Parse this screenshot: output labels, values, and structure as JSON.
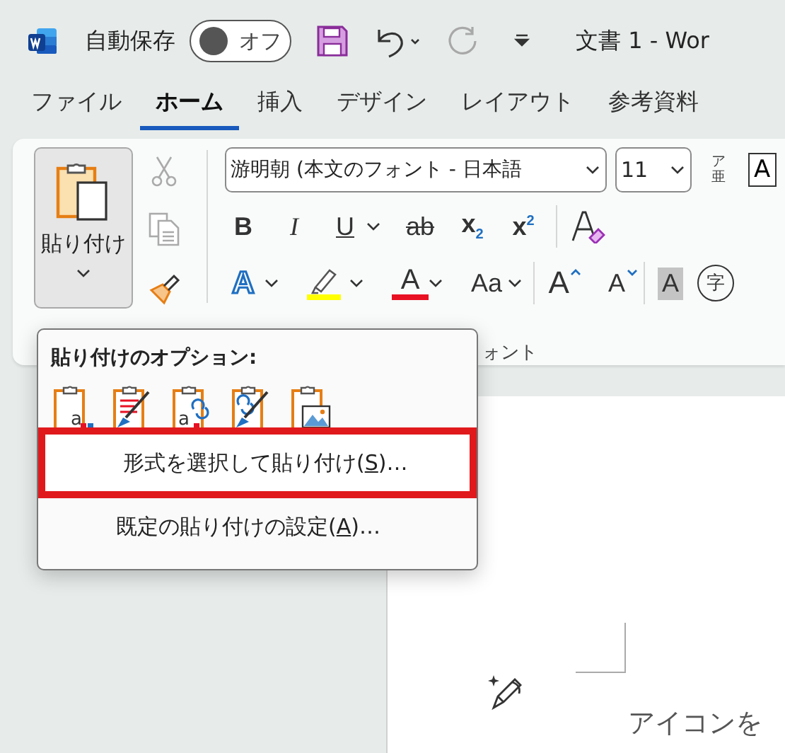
{
  "title_bar": {
    "autosave_label": "自動保存",
    "autosave_toggle": {
      "on": false,
      "label": "オフ"
    },
    "redo_disabled": true,
    "document_title": "文書 1  -  Wor"
  },
  "tabs": [
    {
      "label": "ファイル",
      "selected": false
    },
    {
      "label": "ホーム",
      "selected": true
    },
    {
      "label": "挿入",
      "selected": false
    },
    {
      "label": "デザイン",
      "selected": false
    },
    {
      "label": "レイアウト",
      "selected": false
    },
    {
      "label": "参考資料",
      "selected": false
    }
  ],
  "ribbon": {
    "paste_button": {
      "label": "貼り付け",
      "pressed": true
    },
    "clipboard_tools": [
      {
        "kind": "cut",
        "disabled": true
      },
      {
        "kind": "copy",
        "disabled": true
      },
      {
        "kind": "format-painter",
        "disabled": false
      }
    ],
    "font_name": "游明朝 (本文のフォント - 日本語",
    "font_size": "11",
    "phonetic_guide": {
      "top": "ア",
      "bottom": "亜"
    },
    "enclosed_border_button": "A",
    "format_row": [
      {
        "kind": "bold",
        "label": "B"
      },
      {
        "kind": "italic",
        "label": "I"
      },
      {
        "kind": "underline",
        "label": "U",
        "dropdown": true
      },
      {
        "kind": "strike",
        "label": "ab"
      },
      {
        "kind": "subscript",
        "label": "x",
        "mark": "2"
      },
      {
        "kind": "superscript",
        "label": "x",
        "mark": "2"
      },
      {
        "kind": "clear-format"
      }
    ],
    "color_row": [
      {
        "kind": "text-effects",
        "label": "A",
        "dropdown": true
      },
      {
        "kind": "highlight",
        "color": "#ffff00",
        "dropdown": true
      },
      {
        "kind": "font-color",
        "label": "A",
        "color": "#e81123",
        "dropdown": true
      },
      {
        "kind": "change-case",
        "label": "Aa",
        "dropdown": true
      },
      {
        "kind": "grow-font",
        "label": "A"
      },
      {
        "kind": "shrink-font",
        "label": "A"
      },
      {
        "kind": "shading",
        "label": "A"
      },
      {
        "kind": "enclose",
        "label": "字"
      }
    ],
    "font_group_label": "ォント"
  },
  "paste_menu": {
    "title": "貼り付けのオプション:",
    "options": [
      {
        "kind": "keep-source",
        "letter": "a"
      },
      {
        "kind": "merge"
      },
      {
        "kind": "keep-text-link",
        "letter": "a"
      },
      {
        "kind": "merge-link"
      },
      {
        "kind": "picture"
      }
    ],
    "items": [
      {
        "before": "形式を選択して貼り付け(",
        "key": "S",
        "after": ")…",
        "highlighted": true
      },
      {
        "before": "既定の貼り付けの設定(",
        "key": "A",
        "after": ")…",
        "highlighted": false
      }
    ]
  },
  "document": {
    "body_text": "アイコンを"
  }
}
